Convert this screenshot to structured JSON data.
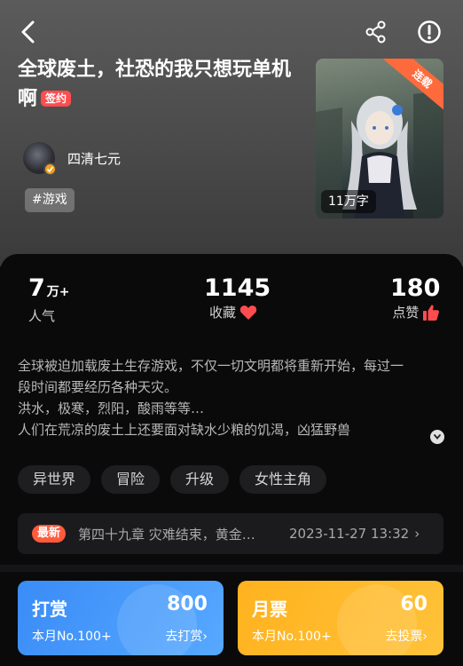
{
  "nav": {
    "back_icon": "chevron-left-icon",
    "share_icon": "share-icon",
    "report_icon": "exclamation-circle-icon"
  },
  "book": {
    "title": "全球废土，社恐的我只想玩单机啊",
    "sign_badge": "签约",
    "author": "四清七元",
    "tag": "#游戏",
    "cover": {
      "serial_badge": "连载",
      "word_count": "11万字"
    }
  },
  "stats": {
    "popularity": {
      "value": "7",
      "unit": "万+",
      "label": "人气"
    },
    "favorites": {
      "value": "1145",
      "label": "收藏",
      "icon": "heart-icon",
      "icon_color": "#ff4d4f"
    },
    "likes": {
      "value": "180",
      "label": "点赞",
      "icon": "thumbs-up-icon",
      "icon_color": "#ff4d4f"
    }
  },
  "synopsis": {
    "lines": [
      "全球被迫加载废土生存游戏，不仅一切文明都将重新开始，每过一",
      "段时间都要经历各种天灾。",
      "洪水，极寒，烈阳，酸雨等等…",
      "人们在荒凉的废土上还要面对缺水少粮的饥渴，凶猛野兽"
    ]
  },
  "genres": [
    "异世界",
    "冒险",
    "升级",
    "女性主角"
  ],
  "latest_chapter": {
    "badge": "最新",
    "title": "第四十九章 灾难结束，黄金…",
    "date": "2023-11-27 13:32",
    "chevron": "›"
  },
  "reward": {
    "title": "打赏",
    "value": "800",
    "rank": "本月No.100+",
    "action": "去打赏",
    "color": "#3a8cf7"
  },
  "monthly_ticket": {
    "title": "月票",
    "value": "60",
    "rank": "本月No.100+",
    "action": "去投票",
    "color": "#ffb21e"
  },
  "colors": {
    "accent_red": "#ff4d4f",
    "header_bg": "#4a4a4a",
    "card_bg": "#0a0a0b"
  }
}
